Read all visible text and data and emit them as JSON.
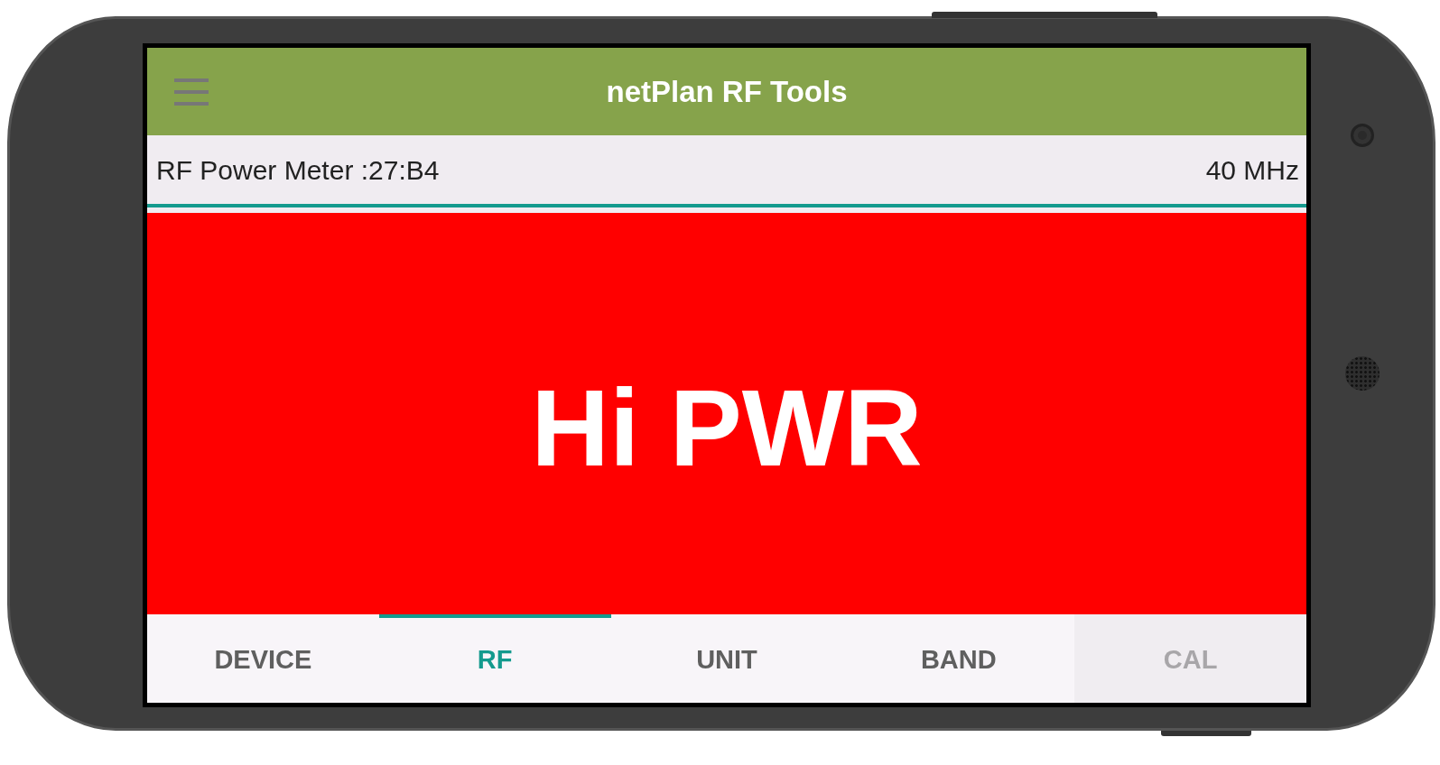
{
  "app_bar": {
    "title": "netPlan RF Tools"
  },
  "status": {
    "device": "RF Power Meter :27:B4",
    "frequency": "40 MHz"
  },
  "reading": "Hi PWR",
  "tabs": [
    {
      "label": "DEVICE",
      "selected": false,
      "disabled": false
    },
    {
      "label": "RF",
      "selected": true,
      "disabled": false
    },
    {
      "label": "UNIT",
      "selected": false,
      "disabled": false
    },
    {
      "label": "BAND",
      "selected": false,
      "disabled": false
    },
    {
      "label": "CAL",
      "selected": false,
      "disabled": true
    }
  ]
}
